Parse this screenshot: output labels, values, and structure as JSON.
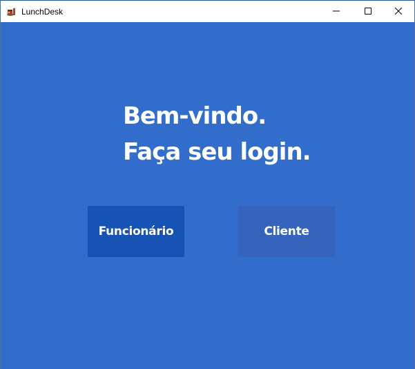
{
  "window": {
    "title": "LunchDesk",
    "icon": "lunch-meal-icon",
    "controls": {
      "minimize": "minimize-icon",
      "maximize": "maximize-icon",
      "close": "close-icon"
    }
  },
  "main": {
    "heading_line1": "Bem-vindo.",
    "heading_line2": "Faça seu login.",
    "buttons": {
      "funcionario": "Funcionário",
      "cliente": "Cliente"
    }
  },
  "colors": {
    "background": "#336dcb",
    "funcionario_button": "#1653b5",
    "cliente_button": "#3664bd",
    "text": "#ffffff"
  }
}
